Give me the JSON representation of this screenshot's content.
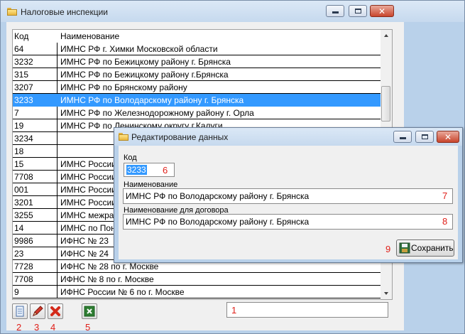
{
  "main_window": {
    "title": "Налоговые инспекции",
    "grid": {
      "columns": [
        "Код",
        "Наименование"
      ],
      "rows": [
        [
          "64",
          "ИМНС РФ г. Химки Московской области"
        ],
        [
          "3232",
          "ИМНС РФ по Бежицкому району г. Брянска"
        ],
        [
          "315",
          "ИМНС РФ по Бежицкому району г.Брянска"
        ],
        [
          "3207",
          "ИМНС РФ по Брянскому району"
        ],
        [
          "3233",
          "ИМНС РФ по Володарскому району г. Брянска"
        ],
        [
          "7",
          "ИМНС РФ по Железнодорожному району г. Орла"
        ],
        [
          "19",
          "ИМНС РФ по Ленинскому округу г.Калуги"
        ],
        [
          "3234",
          ""
        ],
        [
          "18",
          ""
        ],
        [
          "15",
          "ИМНС России"
        ],
        [
          "7708",
          "ИМНС России"
        ],
        [
          "001",
          "ИМНС России"
        ],
        [
          "3201",
          "ИМНС России"
        ],
        [
          "3255",
          "ИМНС межра"
        ],
        [
          "14",
          "ИМНС по Пон"
        ],
        [
          "9986",
          "ИФНС № 23"
        ],
        [
          "23",
          "ИФНС № 24"
        ],
        [
          "7728",
          "ИФНС № 28 по г. Москве"
        ],
        [
          "7708",
          "ИФНС № 8 по г. Москве"
        ],
        [
          "9",
          "ИФНС России № 6 по г. Москве"
        ]
      ],
      "selected_index": 4
    },
    "toolbar": {
      "new_icon": "new-document-icon",
      "edit_icon": "pencil-icon",
      "delete_icon": "delete-x-icon",
      "excel_icon": "excel-export-icon"
    },
    "search_value": "",
    "annotations": {
      "n1": "1",
      "n2": "2",
      "n3": "3",
      "n4": "4",
      "n5": "5"
    }
  },
  "dialog": {
    "title": "Редактирование данных",
    "code_label": "Код",
    "code_value": "3233",
    "name_label": "Наименование",
    "name_value": "ИМНС РФ по Володарскому району г. Брянска",
    "contract_name_label": "Наименование для договора",
    "contract_name_value": "ИМНС РФ по Володарскому району г. Брянска",
    "save_label": "Сохранить",
    "annotations": {
      "n6": "6",
      "n7": "7",
      "n8": "8",
      "n9": "9"
    }
  },
  "colors": {
    "selection": "#3399ff",
    "annotation": "#e0201a",
    "window_frame": "#b9d1ea"
  }
}
